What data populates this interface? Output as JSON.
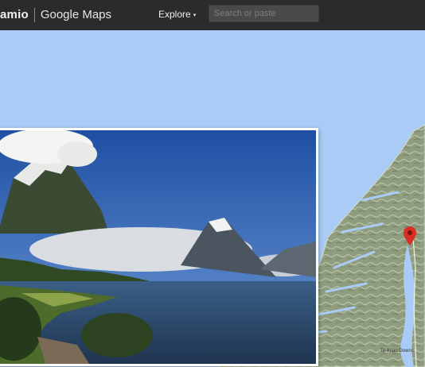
{
  "header": {
    "brand_name": "amio",
    "product_name": "Google Maps",
    "explore_label": "Explore",
    "explore_caret": "▾",
    "search_placeholder": "Search or paste",
    "search_value": ""
  },
  "map": {
    "water_color": "#a9cbf5",
    "land_color": "#8f9c7e",
    "place_labels": [
      "Te Anau Downs"
    ]
  },
  "photo": {
    "subject": "mountain-lake-landscape"
  },
  "marker": {
    "icon": "map-pin-icon",
    "color": "#d93025"
  }
}
